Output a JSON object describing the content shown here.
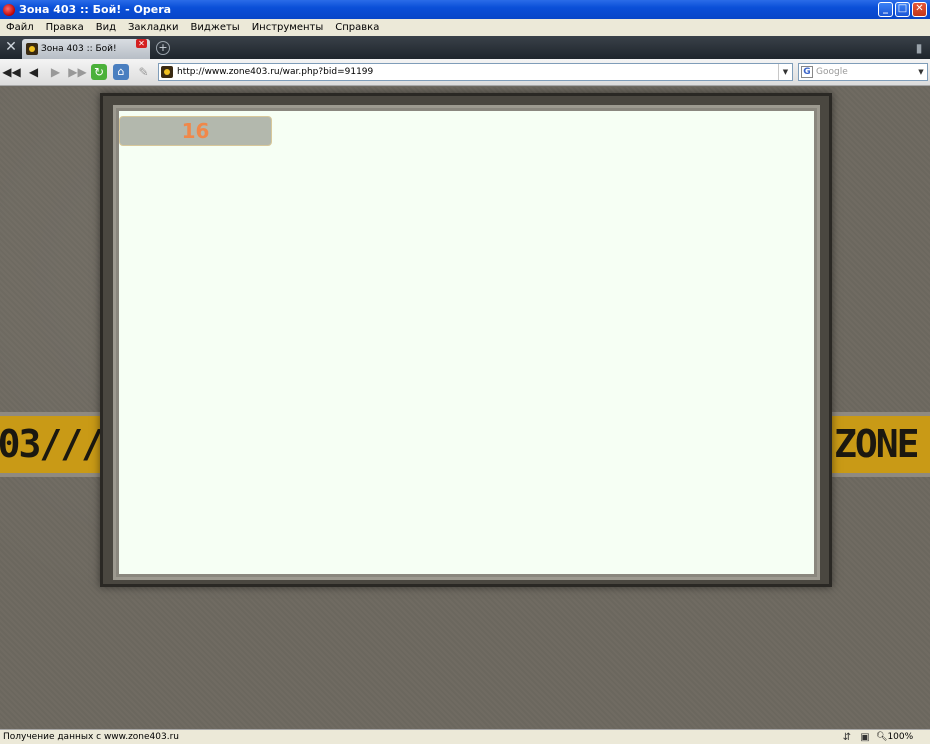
{
  "window": {
    "title": "Зона 403 :: Бой! - Opera",
    "buttons": {
      "minimize": "_",
      "maximize": "□",
      "close": "✕"
    }
  },
  "menubar": {
    "items": [
      "Файл",
      "Правка",
      "Вид",
      "Закладки",
      "Виджеты",
      "Инструменты",
      "Справка"
    ]
  },
  "tabs": [
    {
      "label": "Зона 403 :: Бой!",
      "active": true
    }
  ],
  "toolbar": {
    "url": "http://www.zone403.ru/war.php?bid=91199",
    "search_placeholder": "Google",
    "search_engine": "G"
  },
  "page": {
    "counter": "16",
    "banner_left": "03///",
    "banner_right": "ZONE"
  },
  "statusbar": {
    "text": "Получение данных с www.zone403.ru",
    "zoom": "100%"
  },
  "colors": {
    "titlebar": "#0a4fd8",
    "content_bg": "#f6fff4",
    "counter_text": "#f0884a",
    "tape": "#c99a16"
  }
}
